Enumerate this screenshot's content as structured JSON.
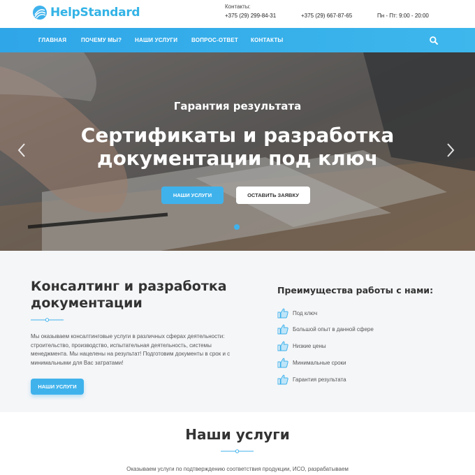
{
  "header": {
    "logo_text": "HelpStandard",
    "contacts_label": "Контакты:",
    "phone1": "+375 (29) 299-84-31",
    "phone2": "+375 (29) 667-87-65",
    "hours": "Пн - Пт: 9:00 - 20:00"
  },
  "nav": {
    "items": [
      "Главная",
      "Почему мы?",
      "Наши услуги",
      "Вопрос-ответ",
      "Контакты"
    ],
    "search_icon": "search-icon"
  },
  "hero": {
    "subtitle": "Гарантия результата",
    "title_line1": "Сертификаты и разработка",
    "title_line2": "документации под ключ",
    "button_services": "Наши услуги",
    "button_request": "Оставить заявку"
  },
  "about": {
    "title_line1": "Консалтинг и разработка",
    "title_line2": "документации",
    "text_line1": "Мы оказываем консалтинговые услуги в различных сферах деятельности:",
    "text_line2": "строительство, производство, испытательная деятельность, системы",
    "text_line3": "менеджмента. Мы нацелены на результат! Подготовим документы в срок и с",
    "text_line4": "минимальными для Вас затратами!",
    "button": "Наши услуги"
  },
  "advantages": {
    "title": "Преимущества работы с нами:",
    "items": [
      {
        "label": "Под ключ",
        "icon": "thumbs-up-icon"
      },
      {
        "label": "Большой опыт в данной сфере",
        "icon": "thumbs-up-icon"
      },
      {
        "label": "Низкие цены",
        "icon": "thumbs-up-icon"
      },
      {
        "label": "Минимальные сроки",
        "icon": "thumbs-up-icon"
      },
      {
        "label": "Гарантия результата",
        "icon": "thumbs-up-icon"
      }
    ]
  },
  "services": {
    "title": "Наши услуги",
    "text": "Оказываем услуги по подтверждению соответствия продукции, ИСО, разрабатываем"
  },
  "colors": {
    "accent": "#3fb2ec",
    "nav_bg": "#2fa6e8",
    "section_bg": "#f5f6f8"
  }
}
